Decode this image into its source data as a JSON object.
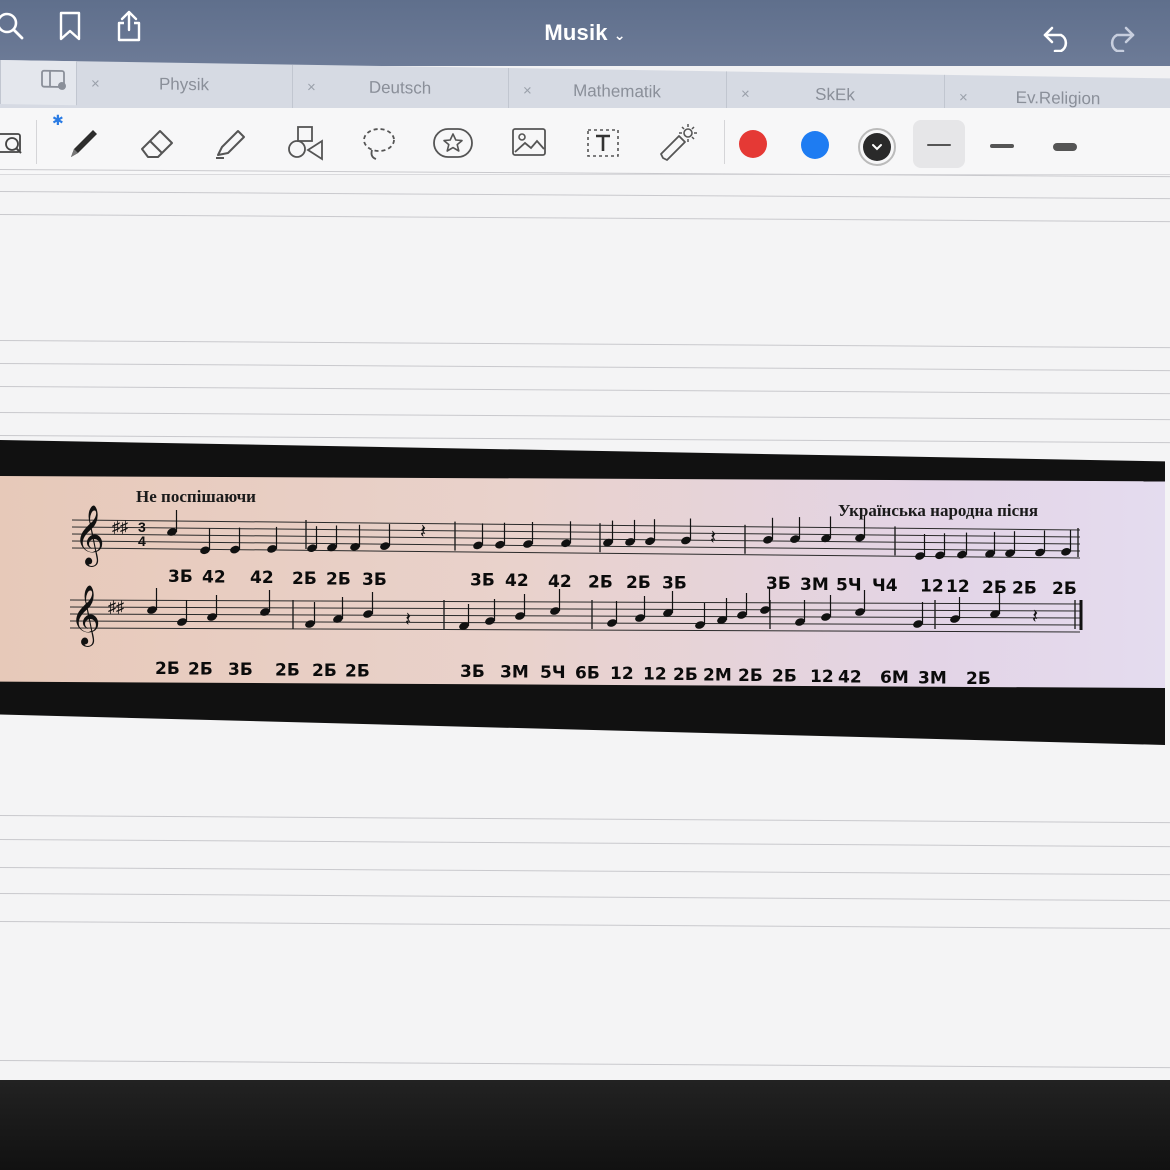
{
  "document": {
    "title": "Musik"
  },
  "tabs": [
    {
      "label": "Physik"
    },
    {
      "label": "Deutsch"
    },
    {
      "label": "Mathematik"
    },
    {
      "label": "SkEk"
    },
    {
      "label": "Ev.Religion"
    }
  ],
  "tab_close_glyph": "×",
  "toolbar": {
    "colors": [
      "#e53935",
      "#1e7cf2",
      "#2a2a2a"
    ]
  },
  "score": {
    "tempo_marking": "Не поспішаючи",
    "source_label": "Українська народна пісня",
    "line1_annotations": [
      "3Б",
      "42",
      "42",
      "2Б",
      "2Б",
      "3Б",
      "3Б",
      "42",
      "42",
      "2Б",
      "2Б",
      "3Б",
      "3Б",
      "3М",
      "5Ч",
      "Ч4",
      "12",
      "12",
      "2Б",
      "2Б",
      "2Б"
    ],
    "line2_annotations": [
      "2Б",
      "2Б",
      "3Б",
      "2Б",
      "2Б",
      "2Б",
      "3Б",
      "3М",
      "5Ч",
      "6Б",
      "12",
      "12",
      "2Б",
      "2М",
      "2Б",
      "2Б",
      "12",
      "42",
      "6М",
      "3М",
      "2Б"
    ]
  }
}
